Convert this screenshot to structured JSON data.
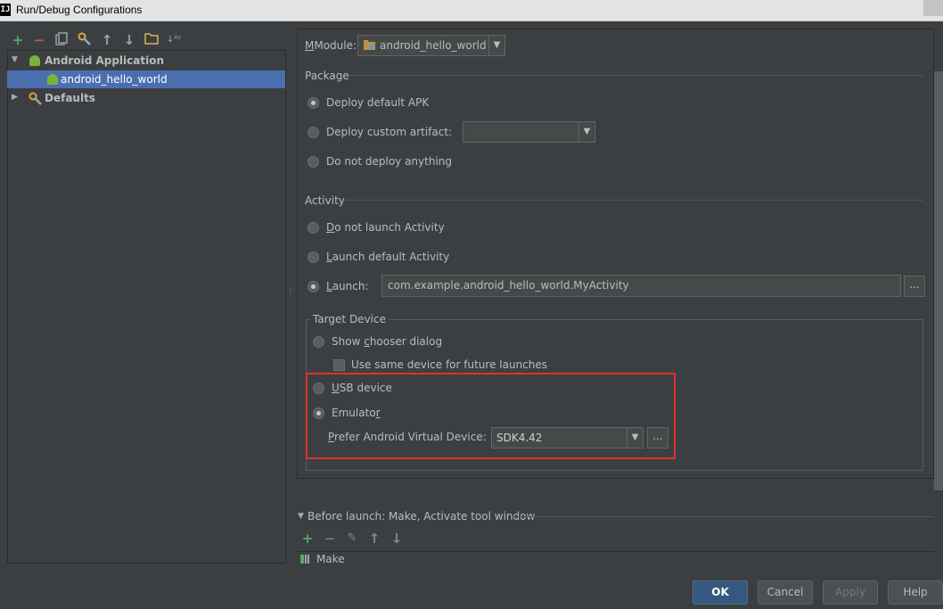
{
  "window": {
    "title": "Run/Debug Configurations",
    "app_icon": "IJ"
  },
  "toolbar": {
    "icons": [
      "add-icon",
      "remove-icon",
      "copy-icon",
      "edit-defaults-icon",
      "move-up-icon",
      "move-down-icon",
      "folder-icon",
      "sort-icon"
    ],
    "add_glyph": "+",
    "remove_glyph": "−",
    "up_glyph": "↑",
    "down_glyph": "↓",
    "sort_glyph": "↓ᴬᶻ"
  },
  "tree": {
    "android_application": "Android Application",
    "config": "android_hello_world",
    "defaults": "Defaults"
  },
  "module": {
    "label": "Module:",
    "value": "android_hello_world"
  },
  "package": {
    "section": "Package",
    "deploy_default": "Deploy default APK",
    "deploy_custom": "Deploy custom artifact:",
    "no_deploy": "Do not deploy anything",
    "artifact_value": ""
  },
  "activity": {
    "section": "Activity",
    "not_launch": "o not launch Activity",
    "not_launch_key": "D",
    "launch_default": "aunch default Activity",
    "launch_default_key": "L",
    "launch": "aunch:",
    "launch_key": "L",
    "launch_value": "com.example.android_hello_world.MyActivity",
    "browse": "..."
  },
  "target": {
    "section": "Target Device",
    "show_chooser_a": "Show ",
    "show_chooser_key": "c",
    "show_chooser_b": "hooser dialog",
    "same_device": "Use same device for future launches",
    "usb_key": "U",
    "usb_rest": "SB device",
    "emulator_a": "Emulato",
    "emulator_key": "r",
    "avd_key": "P",
    "avd_rest": "refer Android Virtual Device:",
    "avd_value": "SDK4.42",
    "avd_browse": "..."
  },
  "before_launch": {
    "title": "Before launch: Make, Activate tool window",
    "item": "Make",
    "glyph_add": "+",
    "glyph_remove": "−",
    "glyph_edit": "✎",
    "glyph_up": "↑",
    "glyph_down": "↓"
  },
  "buttons": {
    "ok": "OK",
    "cancel": "Cancel",
    "apply": "Apply",
    "help": "Help"
  },
  "colors": {
    "accent_selection": "#4b6eaf",
    "highlight_box": "#e0302f",
    "add_green": "#59a869",
    "remove_red": "#c75450"
  }
}
